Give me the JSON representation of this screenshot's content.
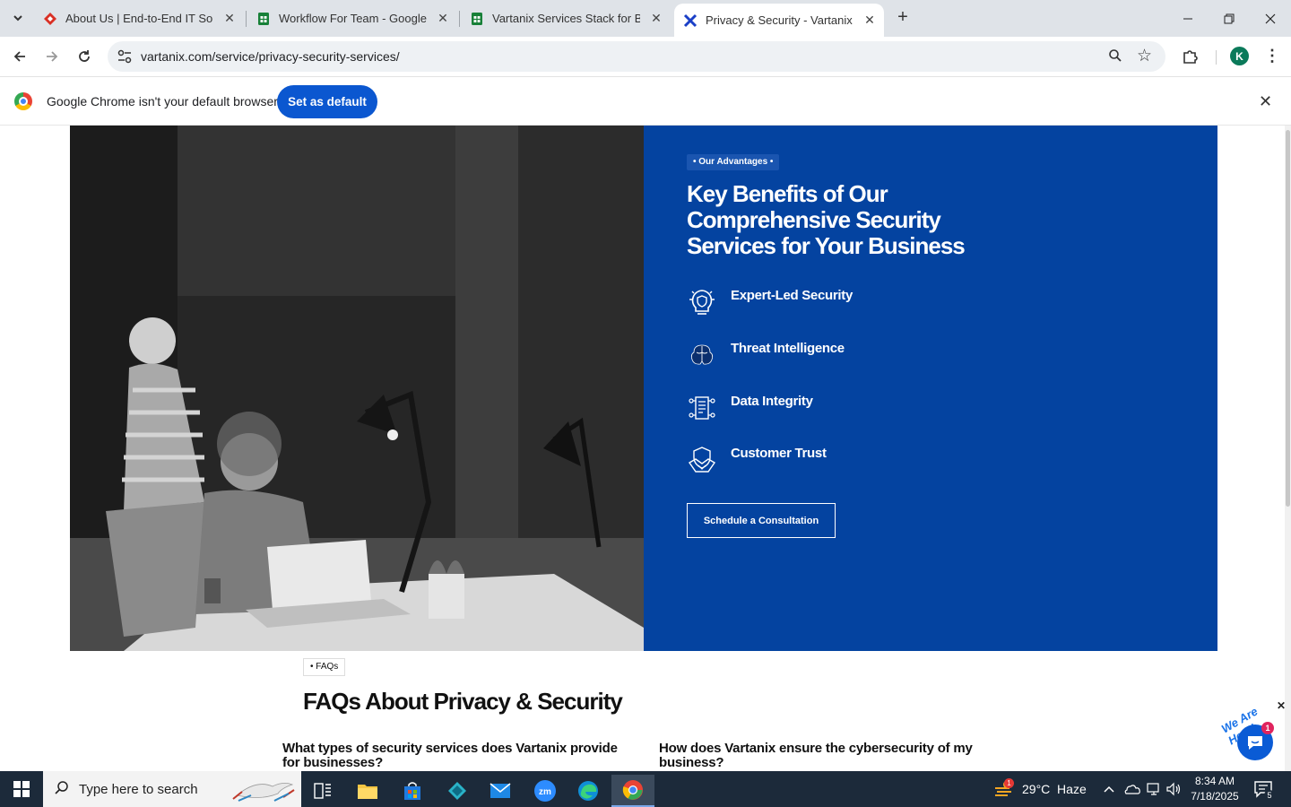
{
  "browser": {
    "tabs": [
      {
        "title": "About Us | End-to-End IT Soluti",
        "favicon": "red-diamond-icon",
        "color": "#d93025"
      },
      {
        "title": "Workflow For Team - Google Sh",
        "favicon": "google-sheets-icon",
        "color": "#188038"
      },
      {
        "title": "Vartanix Services Stack for Blog",
        "favicon": "google-sheets-icon",
        "color": "#188038"
      },
      {
        "title": "Privacy & Security - Vartanix",
        "favicon": "vartanix-x-icon",
        "color": "#1a3fc7"
      }
    ],
    "url": "vartanix.com/service/privacy-security-services/",
    "profile_initial": "K",
    "infobar": {
      "message": "Google Chrome isn't your default browser",
      "button": "Set as default"
    }
  },
  "section_advantages": {
    "badge": "• Our Advantages •",
    "headline": "Key Benefits of Our Comprehensive Security Services for Your Business",
    "benefits": [
      {
        "label": "Expert-Led Security",
        "icon": "bulb-shield-icon"
      },
      {
        "label": "Threat Intelligence",
        "icon": "brain-icon"
      },
      {
        "label": "Data Integrity",
        "icon": "document-network-icon"
      },
      {
        "label": "Customer Trust",
        "icon": "handshake-icon"
      }
    ],
    "cta": "Schedule a Consultation",
    "panel_color": "#0443a0"
  },
  "faq": {
    "badge": "• FAQs",
    "title": "FAQs About Privacy & Security",
    "questions": [
      "What types of security services does Vartanix provide for businesses?",
      "How does Vartanix ensure the cybersecurity of my business?"
    ]
  },
  "chat_widget": {
    "tagline": "We Are Here!",
    "count": "1"
  },
  "taskbar": {
    "search_placeholder": "Type here to search",
    "weather": "29°C  Haze",
    "weather_badge": "1",
    "time": "8:34 AM",
    "date": "7/18/2025",
    "notification_count": "5"
  }
}
